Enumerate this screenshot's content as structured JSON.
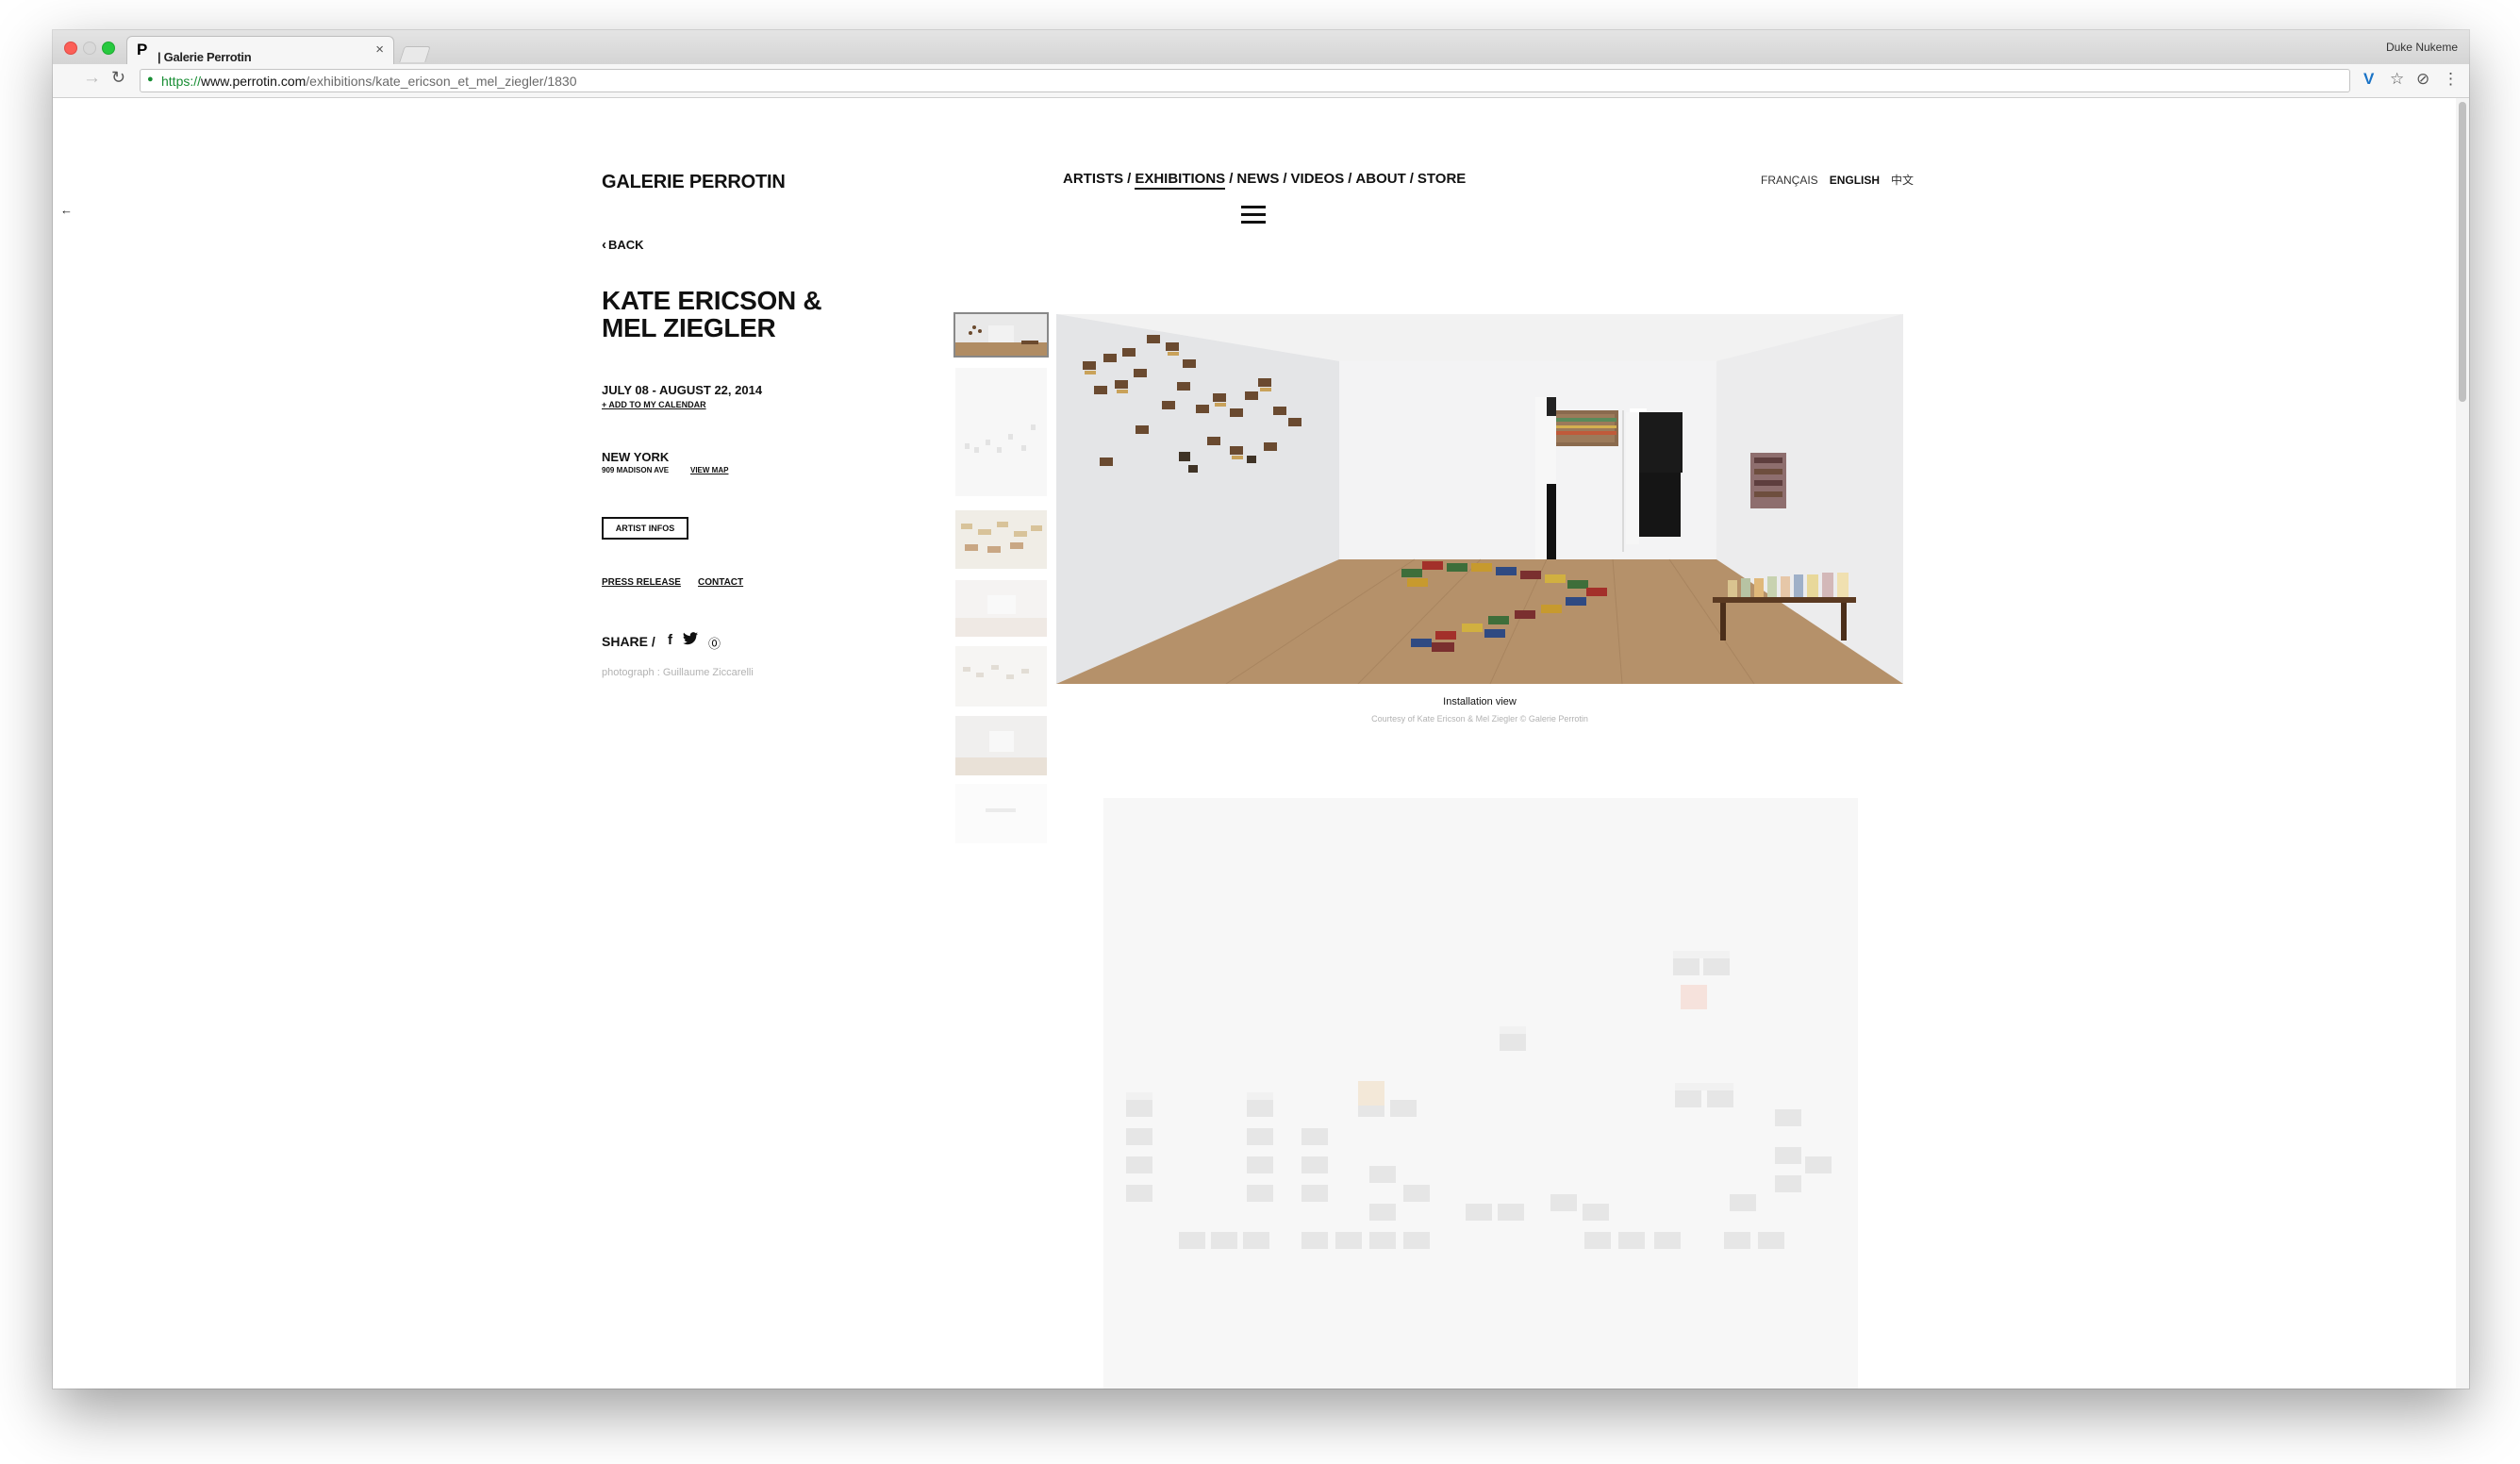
{
  "browser": {
    "tab_title": "| Galerie Perrotin",
    "tab_favicon": "P",
    "profile_name": "Duke Nukeme",
    "url_protocol": "https://",
    "url_host": "www.perrotin.com",
    "url_path": "/exhibitions/kate_ericson_et_mel_ziegler/1830"
  },
  "header": {
    "logo": "GALERIE PERROTIN",
    "nav": [
      {
        "label": "ARTISTS"
      },
      {
        "label": "EXHIBITIONS"
      },
      {
        "label": "NEWS"
      },
      {
        "label": "VIDEOS"
      },
      {
        "label": "ABOUT"
      },
      {
        "label": "STORE"
      }
    ],
    "nav_separator": "/",
    "active_nav": "EXHIBITIONS",
    "languages": [
      {
        "label": "FRANÇAIS"
      },
      {
        "label": "ENGLISH"
      },
      {
        "label": "中文"
      }
    ],
    "active_language": "ENGLISH"
  },
  "sidebar": {
    "back": "BACK",
    "title_line1": "KATE ERICSON &",
    "title_line2": "MEL ZIEGLER",
    "dates": "JULY 08 - AUGUST 22, 2014",
    "add_calendar": "+ ADD TO MY CALENDAR",
    "city": "NEW YORK",
    "address": "909 MADISON AVE",
    "view_map": "VIEW MAP",
    "artist_infos": "ARTIST INFOS",
    "press_release": "PRESS RELEASE",
    "contact": "CONTACT",
    "share": "SHARE /",
    "photo_credit": "photograph : Guillaume Ziccarelli"
  },
  "gallery": {
    "thumbnails": [
      {
        "name": "thumb-1",
        "selected": true
      },
      {
        "name": "thumb-2",
        "selected": false
      },
      {
        "name": "thumb-3",
        "selected": false
      },
      {
        "name": "thumb-4",
        "selected": false
      },
      {
        "name": "thumb-5",
        "selected": false
      },
      {
        "name": "thumb-6",
        "selected": false
      },
      {
        "name": "thumb-7",
        "selected": false
      }
    ],
    "caption": "Installation view",
    "credit": "Courtesy of Kate Ericson & Mel Ziegler © Galerie Perrotin"
  },
  "colors": {
    "text": "#111111",
    "muted": "#b2b2b2",
    "secure_green": "#178d33",
    "floor": "#a5845f"
  },
  "icons": {
    "back": "chevron-left-icon",
    "menu": "hamburger-icon",
    "share_facebook": "facebook-icon",
    "share_twitter": "twitter-icon",
    "share_pinterest": "pinterest-icon"
  }
}
